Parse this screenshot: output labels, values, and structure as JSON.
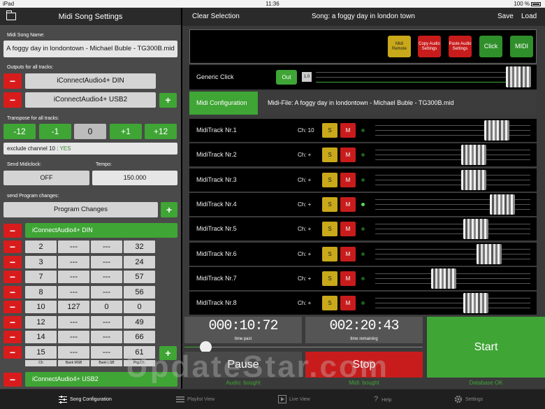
{
  "status": {
    "device": "iPad",
    "time": "11:36",
    "battery": "100 %"
  },
  "left": {
    "title": "Midi Song Settings",
    "song_name_label": "Midi Song Name:",
    "song_name_value": "A foggy day in londontown - Michael Buble - TG300B.mid",
    "outputs_label": "Outputs for all tracks:",
    "outputs": [
      "iConnectAudio4+ DIN",
      "iConnectAudio4+ USB2"
    ],
    "transpose_label": "Transpose for all tracks:",
    "transpose": [
      "-12",
      "-1",
      "0",
      "+1",
      "+12"
    ],
    "exclude_label": "exclude channel 10 :",
    "exclude_value": "YES",
    "midiclock_label": "Send Midiclock:",
    "midiclock_value": "OFF",
    "tempo_label": "Tempo:",
    "tempo_value": "150.000",
    "program_label": "send Program changes:",
    "program_button": "Program Changes",
    "device1": "iConnectAudio4+ DIN",
    "device2": "iConnectAudio4+ USB2",
    "grid": [
      [
        "2",
        "---",
        "---",
        "32"
      ],
      [
        "3",
        "---",
        "---",
        "24"
      ],
      [
        "7",
        "---",
        "---",
        "57"
      ],
      [
        "8",
        "---",
        "---",
        "56"
      ],
      [
        "10",
        "127",
        "0",
        "0"
      ],
      [
        "12",
        "---",
        "---",
        "49"
      ],
      [
        "14",
        "---",
        "---",
        "66"
      ],
      [
        "15",
        "---",
        "---",
        "61"
      ]
    ],
    "grid_labels": [
      "Ch",
      "Bank MSB",
      "Bank LSB",
      "Prg.Ch."
    ],
    "minus": "−",
    "plus": "+"
  },
  "right": {
    "clear": "Clear Selection",
    "song": "Song: a foggy day in london town",
    "save": "Save",
    "load": "Load",
    "top_buttons": [
      "Midi Remote",
      "Copy Audio Settings",
      "Paste Audio Settings",
      "Click",
      "MIDI"
    ],
    "generic_click": "Generic Click",
    "out": "Out",
    "click_value": "1.0",
    "midi_config": "Midi Configuration",
    "midi_file": "Midi-File:  A foggy day in londontown - Michael Buble - TG300B.mid",
    "tracks": [
      {
        "name": "MidiTrack Nr.1",
        "ch": "Ch: 10",
        "led": false,
        "thumb": 0.84
      },
      {
        "name": "MidiTrack Nr.2",
        "ch": "Ch: +",
        "led": false,
        "thumb": 0.66
      },
      {
        "name": "MidiTrack Nr.3",
        "ch": "Ch: +",
        "led": false,
        "thumb": 0.66
      },
      {
        "name": "MidiTrack Nr.4",
        "ch": "Ch: +",
        "led": true,
        "thumb": 0.88
      },
      {
        "name": "MidiTrack Nr.5",
        "ch": "Ch: +",
        "led": false,
        "thumb": 0.68
      },
      {
        "name": "MidiTrack Nr.6",
        "ch": "Ch: +",
        "led": false,
        "thumb": 0.78
      },
      {
        "name": "MidiTrack Nr.7",
        "ch": "Ch: +",
        "led": false,
        "thumb": 0.43
      },
      {
        "name": "MidiTrack Nr.8",
        "ch": "Ch: +",
        "led": false,
        "thumb": 0.68
      }
    ],
    "S": "S",
    "M": "M",
    "time_past": "000:10:72",
    "time_past_label": "time past",
    "time_remaining": "002:20:43",
    "time_remaining_label": "time remaining",
    "start": "Start",
    "pause": "Pause",
    "stop": "Stop",
    "audio_status": "Audio: bought",
    "midi_status": "Midi: bought",
    "db_status": "Database OK",
    "progress": 0.06
  },
  "tabs": [
    "Song Configuration",
    "Playlist View",
    "Live View",
    "Help",
    "Settings"
  ],
  "watermark": "UpdateStar.com",
  "colors": {
    "green": "#3fa535",
    "red": "#d81c1c",
    "gold": "#c9a81a"
  }
}
